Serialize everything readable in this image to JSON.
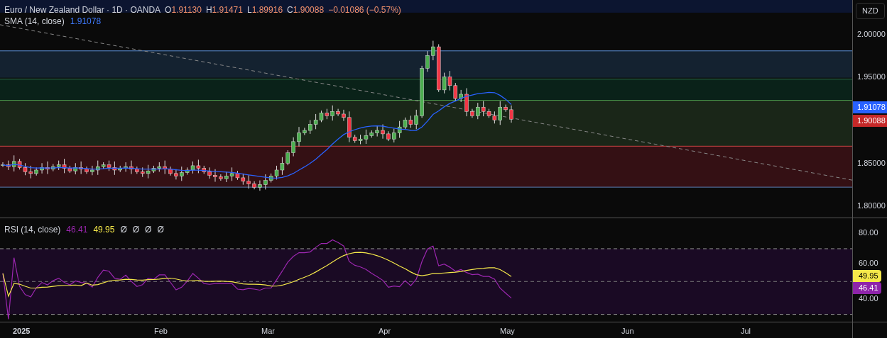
{
  "legend": {
    "symbol": "Euro / New Zealand Dollar · 1D · OANDA",
    "ohlc": [
      {
        "label": "O",
        "value": "1.91130"
      },
      {
        "label": "H",
        "value": "1.91471"
      },
      {
        "label": "L",
        "value": "1.89916"
      },
      {
        "label": "C",
        "value": "1.90088"
      }
    ],
    "change": "−0.01086 (−0.57%)"
  },
  "sma": {
    "name": "SMA (14, close)",
    "value": "1.91078"
  },
  "rsi": {
    "name": "RSI (14, close)",
    "value": "46.41",
    "signal": "49.95",
    "extras": [
      "Ø",
      "Ø",
      "Ø",
      "Ø"
    ]
  },
  "price_axis": {
    "currency": "NZD",
    "ticks": [
      "2.00000",
      "1.95000",
      "1.85000",
      "1.80000"
    ],
    "badges": [
      {
        "value": "1.91078",
        "color": "#2962ff"
      },
      {
        "value": "1.90088",
        "color": "#c62828"
      }
    ]
  },
  "rsi_axis": {
    "ticks": [
      "80.00",
      "60.00",
      "40.00"
    ],
    "badges": [
      {
        "value": "49.95",
        "color": "#f5e84a"
      },
      {
        "value": "46.41",
        "color": "#8e24aa"
      }
    ]
  },
  "time_axis": {
    "labels": [
      "2025",
      "Feb",
      "Mar",
      "Apr",
      "May",
      "Jun",
      "Jul"
    ]
  }
}
